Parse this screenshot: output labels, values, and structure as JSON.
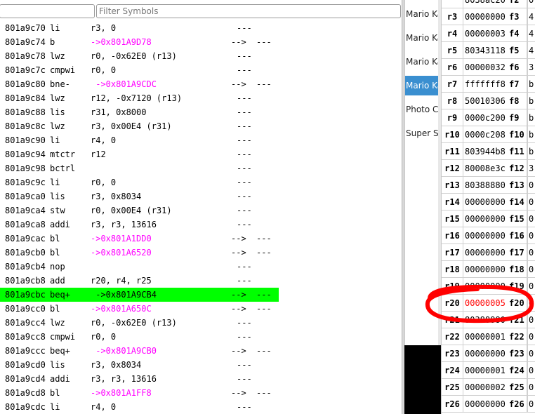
{
  "filter": {
    "placeholder": "Filter Symbols",
    "value": ""
  },
  "code": [
    {
      "addr": "801a9c70",
      "op": "li",
      "args": "r3, 0",
      "branch": false,
      "arrow": "",
      "dash": "---",
      "hl": false
    },
    {
      "addr": "801a9c74",
      "op": "b",
      "args": "->0x801A9D78",
      "branch": true,
      "arrow": "-->",
      "dash": "---",
      "hl": false
    },
    {
      "addr": "801a9c78",
      "op": "lwz",
      "args": "r0, -0x62E0 (r13)",
      "branch": false,
      "arrow": "",
      "dash": "---",
      "hl": false
    },
    {
      "addr": "801a9c7c",
      "op": "cmpwi",
      "args": "r0, 0",
      "branch": false,
      "arrow": "",
      "dash": "---",
      "hl": false
    },
    {
      "addr": "801a9c80",
      "op": "bne-",
      "args": " ->0x801A9CDC",
      "branch": true,
      "arrow": "-->",
      "dash": "---",
      "hl": false
    },
    {
      "addr": "801a9c84",
      "op": "lwz",
      "args": "r12, -0x7120 (r13)",
      "branch": false,
      "arrow": "",
      "dash": "---",
      "hl": false
    },
    {
      "addr": "801a9c88",
      "op": "lis",
      "args": "r31, 0x8000",
      "branch": false,
      "arrow": "",
      "dash": "---",
      "hl": false
    },
    {
      "addr": "801a9c8c",
      "op": "lwz",
      "args": "r3, 0x00E4 (r31)",
      "branch": false,
      "arrow": "",
      "dash": "---",
      "hl": false
    },
    {
      "addr": "801a9c90",
      "op": "li",
      "args": "r4, 0",
      "branch": false,
      "arrow": "",
      "dash": "---",
      "hl": false
    },
    {
      "addr": "801a9c94",
      "op": "mtctr",
      "args": "r12",
      "branch": false,
      "arrow": "",
      "dash": "---",
      "hl": false
    },
    {
      "addr": "801a9c98",
      "op": "bctrl",
      "args": "",
      "branch": false,
      "arrow": "",
      "dash": "---",
      "hl": false
    },
    {
      "addr": "801a9c9c",
      "op": "li",
      "args": "r0, 0",
      "branch": false,
      "arrow": "",
      "dash": "---",
      "hl": false
    },
    {
      "addr": "801a9ca0",
      "op": "lis",
      "args": "r3, 0x8034",
      "branch": false,
      "arrow": "",
      "dash": "---",
      "hl": false
    },
    {
      "addr": "801a9ca4",
      "op": "stw",
      "args": "r0, 0x00E4 (r31)",
      "branch": false,
      "arrow": "",
      "dash": "---",
      "hl": false
    },
    {
      "addr": "801a9ca8",
      "op": "addi",
      "args": "r3, r3, 13616",
      "branch": false,
      "arrow": "",
      "dash": "---",
      "hl": false
    },
    {
      "addr": "801a9cac",
      "op": "bl",
      "args": "->0x801A1DD0",
      "branch": true,
      "arrow": "-->",
      "dash": "---",
      "hl": false
    },
    {
      "addr": "801a9cb0",
      "op": "bl",
      "args": "->0x801A6520",
      "branch": true,
      "arrow": "-->",
      "dash": "---",
      "hl": false
    },
    {
      "addr": "801a9cb4",
      "op": "nop",
      "args": "",
      "branch": false,
      "arrow": "",
      "dash": "---",
      "hl": false
    },
    {
      "addr": "801a9cb8",
      "op": "add",
      "args": "r20, r4, r25",
      "branch": false,
      "arrow": "",
      "dash": "---",
      "hl": false
    },
    {
      "addr": "801a9cbc",
      "op": "beq+",
      "args": " ->0x801A9CB4",
      "branch": true,
      "arrow": "-->",
      "dash": "---",
      "hl": true
    },
    {
      "addr": "801a9cc0",
      "op": "bl",
      "args": "->0x801A650C",
      "branch": true,
      "arrow": "-->",
      "dash": "---",
      "hl": false
    },
    {
      "addr": "801a9cc4",
      "op": "lwz",
      "args": "r0, -0x62E0 (r13)",
      "branch": false,
      "arrow": "",
      "dash": "---",
      "hl": false
    },
    {
      "addr": "801a9cc8",
      "op": "cmpwi",
      "args": "r0, 0",
      "branch": false,
      "arrow": "",
      "dash": "---",
      "hl": false
    },
    {
      "addr": "801a9ccc",
      "op": "beq+",
      "args": " ->0x801A9CB0",
      "branch": true,
      "arrow": "-->",
      "dash": "---",
      "hl": false
    },
    {
      "addr": "801a9cd0",
      "op": "lis",
      "args": "r3, 0x8034",
      "branch": false,
      "arrow": "",
      "dash": "---",
      "hl": false
    },
    {
      "addr": "801a9cd4",
      "op": "addi",
      "args": "r3, r3, 13616",
      "branch": false,
      "arrow": "",
      "dash": "---",
      "hl": false
    },
    {
      "addr": "801a9cd8",
      "op": "bl",
      "args": "->0x801A1FF8",
      "branch": true,
      "arrow": "-->",
      "dash": "---",
      "hl": false
    },
    {
      "addr": "801a9cdc",
      "op": "li",
      "args": "r4, 0",
      "branch": false,
      "arrow": "",
      "dash": "---",
      "hl": false
    }
  ],
  "games": [
    {
      "label": "Mario Ka",
      "selected": false
    },
    {
      "label": "Mario Ka",
      "selected": false
    },
    {
      "label": "Mario Ka",
      "selected": false
    },
    {
      "label": "Mario Ka",
      "selected": true
    },
    {
      "label": "Photo Cl",
      "selected": false
    },
    {
      "label": "Super Sr",
      "selected": false
    }
  ],
  "registers_partial_top": {
    "val": "8038ac20",
    "fname": "f2",
    "fval": "0"
  },
  "registers": [
    {
      "name": "r3",
      "val": "00000000",
      "fname": "f3",
      "fval": "4",
      "changed": false
    },
    {
      "name": "r4",
      "val": "00000003",
      "fname": "f4",
      "fval": "4",
      "changed": false
    },
    {
      "name": "r5",
      "val": "80343118",
      "fname": "f5",
      "fval": "4",
      "changed": false
    },
    {
      "name": "r6",
      "val": "00000032",
      "fname": "f6",
      "fval": "3",
      "changed": false
    },
    {
      "name": "r7",
      "val": "fffffff8",
      "fname": "f7",
      "fval": "b",
      "changed": false
    },
    {
      "name": "r8",
      "val": "50010306",
      "fname": "f8",
      "fval": "b",
      "changed": false
    },
    {
      "name": "r9",
      "val": "0000c200",
      "fname": "f9",
      "fval": "b",
      "changed": false
    },
    {
      "name": "r10",
      "val": "0000c208",
      "fname": "f10",
      "fval": "b",
      "changed": false
    },
    {
      "name": "r11",
      "val": "803944b8",
      "fname": "f11",
      "fval": "b",
      "changed": false
    },
    {
      "name": "r12",
      "val": "80008e3c",
      "fname": "f12",
      "fval": "3",
      "changed": false
    },
    {
      "name": "r13",
      "val": "80388880",
      "fname": "f13",
      "fval": "0",
      "changed": false
    },
    {
      "name": "r14",
      "val": "00000000",
      "fname": "f14",
      "fval": "0",
      "changed": false
    },
    {
      "name": "r15",
      "val": "00000000",
      "fname": "f15",
      "fval": "0",
      "changed": false
    },
    {
      "name": "r16",
      "val": "00000000",
      "fname": "f16",
      "fval": "0",
      "changed": false
    },
    {
      "name": "r17",
      "val": "00000000",
      "fname": "f17",
      "fval": "0",
      "changed": false
    },
    {
      "name": "r18",
      "val": "00000000",
      "fname": "f18",
      "fval": "0",
      "changed": false
    },
    {
      "name": "r19",
      "val": "00000000",
      "fname": "f19",
      "fval": "0",
      "changed": false
    },
    {
      "name": "r20",
      "val": "00000005",
      "fname": "f20",
      "fval": "0",
      "changed": true
    },
    {
      "name": "r21",
      "val": "80388880",
      "fname": "f21",
      "fval": "0",
      "changed": false
    },
    {
      "name": "r22",
      "val": "00000001",
      "fname": "f22",
      "fval": "0",
      "changed": false
    },
    {
      "name": "r23",
      "val": "00000000",
      "fname": "f23",
      "fval": "0",
      "changed": false
    },
    {
      "name": "r24",
      "val": "00000001",
      "fname": "f24",
      "fval": "0",
      "changed": false
    },
    {
      "name": "r25",
      "val": "00000002",
      "fname": "f25",
      "fval": "0",
      "changed": false
    },
    {
      "name": "r26",
      "val": "00000000",
      "fname": "f26",
      "fval": "0",
      "changed": false
    }
  ],
  "colors": {
    "highlight": "#00ff00",
    "branch": "#ff00ff",
    "changed": "#ff0000",
    "selected": "#3a8fd0",
    "annotation": "#ff0000"
  }
}
